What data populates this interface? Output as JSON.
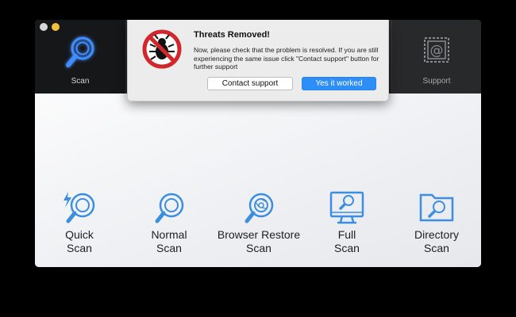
{
  "window": {
    "toolbar": {
      "scan": {
        "label": "Scan",
        "icon": "magnifier-icon"
      },
      "support": {
        "label": "Support",
        "icon": "at-stamp-icon"
      }
    },
    "scan_options": [
      {
        "label": "Quick\nScan",
        "icon": "quick-scan-icon"
      },
      {
        "label": "Normal\nScan",
        "icon": "magnifier-icon"
      },
      {
        "label": "Browser Restore\nScan",
        "icon": "browser-scan-icon"
      },
      {
        "label": "Full\nScan",
        "icon": "monitor-scan-icon"
      },
      {
        "label": "Directory\nScan",
        "icon": "folder-scan-icon"
      }
    ]
  },
  "dialog": {
    "title": "Threats Removed!",
    "message": "Now, please check that the problem is resolved. If you are still experiencing the same issue click \"Contact support\" button for further support",
    "contact_label": "Contact support",
    "yes_label": "Yes it worked",
    "icon": "no-bug-icon"
  },
  "colors": {
    "accent": "#2d8ef7",
    "icon_blue": "#3b8ee0",
    "glow_blue": "#2a7bff",
    "stop_red": "#d0262c"
  }
}
